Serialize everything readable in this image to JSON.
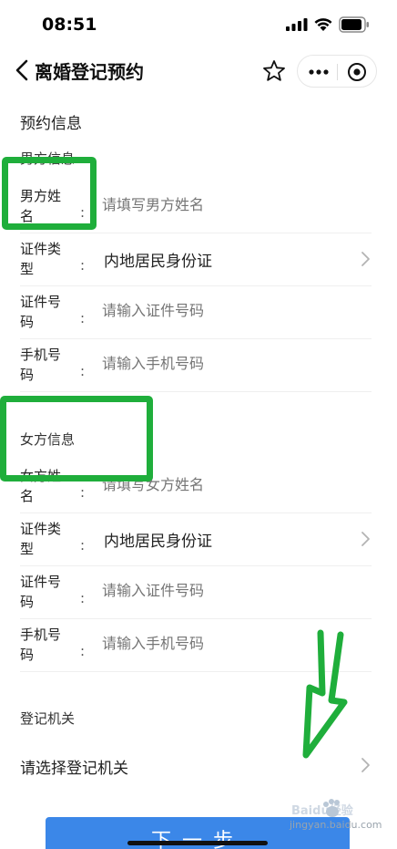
{
  "status_bar": {
    "time": "08:51"
  },
  "nav": {
    "title": "离婚登记预约"
  },
  "form": {
    "section_title": "预约信息",
    "male": {
      "group_title": "男方信息",
      "name_label": "男方姓名",
      "name_placeholder": "请填写男方姓名",
      "id_type_label": "证件类型",
      "id_type_value": "内地居民身份证",
      "id_no_label": "证件号码",
      "id_no_placeholder": "请输入证件号码",
      "phone_label": "手机号码",
      "phone_placeholder": "请输入手机号码"
    },
    "female": {
      "group_title": "女方信息",
      "name_label": "女方姓名",
      "name_placeholder": "请填写女方姓名",
      "id_type_label": "证件类型",
      "id_type_value": "内地居民身份证",
      "id_no_label": "证件号码",
      "id_no_placeholder": "请输入证件号码",
      "phone_label": "手机号码",
      "phone_placeholder": "请输入手机号码"
    },
    "colon": ":",
    "office_title": "登记机关",
    "office_select": "请选择登记机关"
  },
  "next_button": "下一步",
  "watermark": {
    "brand": "Baidu经验",
    "url": "jingyan.baidu.com"
  },
  "colors": {
    "highlight": "#1fae3b",
    "primary": "#3b87e8",
    "placeholder": "#cfcfcf"
  }
}
